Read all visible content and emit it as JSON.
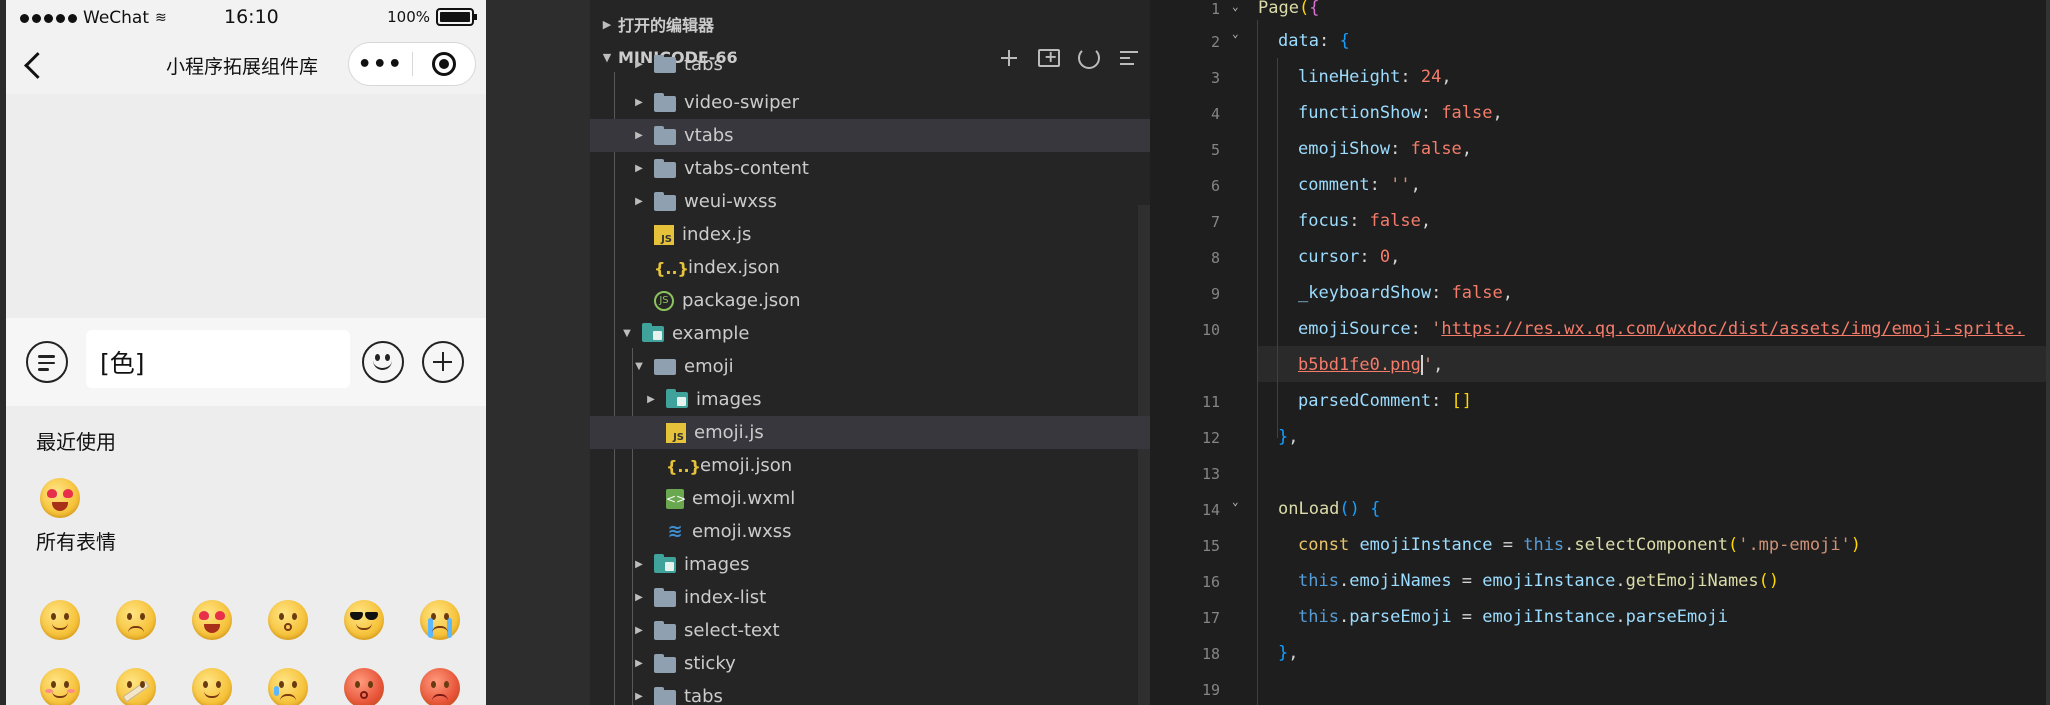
{
  "phone": {
    "status": {
      "carrier": "WeChat",
      "time": "16:10",
      "battery": "100%"
    },
    "nav": {
      "title": "小程序拓展组件库",
      "more_icon": "•••"
    },
    "input": {
      "value": "[色]"
    },
    "sections": {
      "recent": "最近使用",
      "all": "所有表情"
    }
  },
  "explorer": {
    "open_editors": "打开的编辑器",
    "project": "MINICODE-66",
    "items": [
      {
        "label": "tabs"
      },
      {
        "label": "video-swiper"
      },
      {
        "label": "vtabs"
      },
      {
        "label": "vtabs-content"
      },
      {
        "label": "weui-wxss"
      },
      {
        "label": "index.js"
      },
      {
        "label": "index.json"
      },
      {
        "label": "package.json"
      },
      {
        "label": "example"
      },
      {
        "label": "emoji"
      },
      {
        "label": "images"
      },
      {
        "label": "emoji.js"
      },
      {
        "label": "emoji.json"
      },
      {
        "label": "emoji.wxml"
      },
      {
        "label": "emoji.wxss"
      },
      {
        "label": "images"
      },
      {
        "label": "index-list"
      },
      {
        "label": "select-text"
      },
      {
        "label": "sticky"
      },
      {
        "label": "tabs"
      }
    ]
  },
  "editor": {
    "line_numbers": [
      "1",
      "2",
      "3",
      "4",
      "5",
      "6",
      "7",
      "8",
      "9",
      "10",
      "11",
      "12",
      "13",
      "14",
      "15",
      "16",
      "17",
      "18",
      "19"
    ],
    "t": {
      "page": "Page",
      "data": "data",
      "lineHeight": "lineHeight",
      "n24": "24",
      "functionShow": "functionShow",
      "emojiShow": "emojiShow",
      "comment": "comment",
      "emptystr": "''",
      "focus": "focus",
      "cursor": "cursor",
      "n0": "0",
      "keyboardShow": "_keyboardShow",
      "emojiSource": "emojiSource",
      "url1": "https://res.wx.qq.com/wxdoc/dist/assets/img/emoji-sprite.",
      "url2": "b5bd1fe0.png",
      "parsedComment": "parsedComment",
      "onLoad": "onLoad",
      "const": "const",
      "emojiInstance": "emojiInstance",
      "this": "this",
      "selectComponent": "selectComponent",
      "mpEmoji": "'.mp-emoji'",
      "emojiNames": "emojiNames",
      "getEmojiNames": "getEmojiNames",
      "parseEmoji": "parseEmoji",
      "false": "false"
    }
  }
}
